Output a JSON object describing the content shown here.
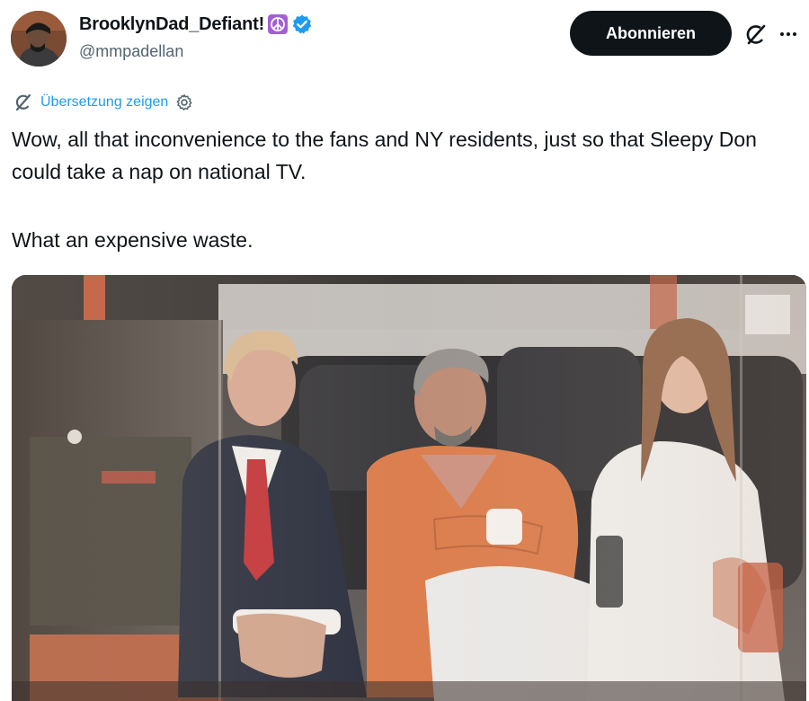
{
  "author": {
    "display_name": "BrooklynDad_Defiant!",
    "badge_icon": "peace-symbol-icon",
    "badge_color": "#a35fd6",
    "verified_icon": "verified-badge-icon",
    "verified_color": "#1d9bf0",
    "handle": "@mmpadellan"
  },
  "actions": {
    "follow_label": "Abonnieren",
    "grok_icon": "grok-icon",
    "more_icon": "more-options-icon"
  },
  "translation": {
    "label": "Übersetzung zeigen",
    "color": "#1d9bf0"
  },
  "tweet": {
    "paragraphs": [
      "Wow, all that inconvenience to the fans and NY residents, just so that Sleepy Don could take a nap on national TV.",
      "What an expensive waste."
    ]
  },
  "media": {
    "type": "video-still"
  }
}
